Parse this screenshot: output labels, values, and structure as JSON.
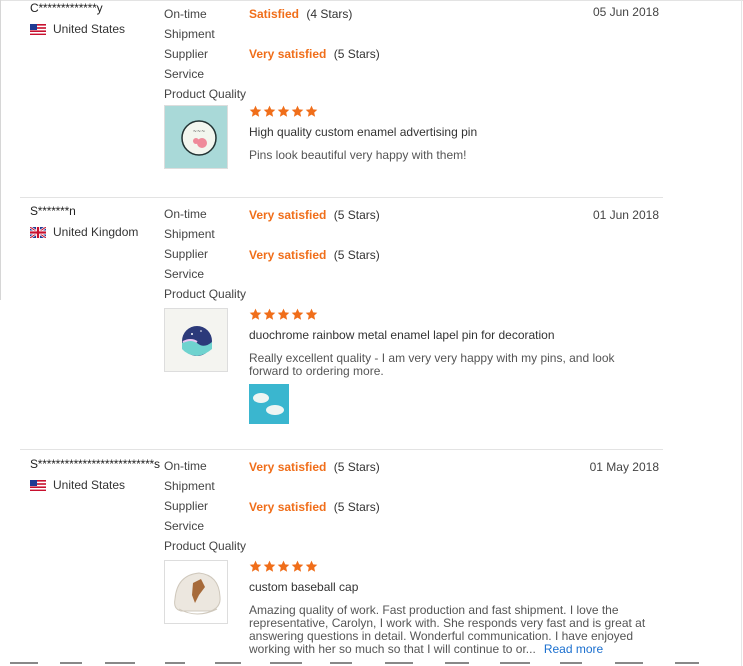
{
  "labels": {
    "ontime_1": "On-time",
    "ontime_2": "Shipment",
    "supplier_1": "Supplier",
    "supplier_2": "Service",
    "product_quality": "Product Quality",
    "read_more": "Read more"
  },
  "colors": {
    "accent": "#f06e1a",
    "link": "#1a6fcf",
    "star": "#f06e1a"
  },
  "reviews": [
    {
      "buyer": "C*************y",
      "country": "United States",
      "flag": "us-flag-icon",
      "ontime_rating": "Satisfied",
      "ontime_stars": "(4 Stars)",
      "supplier_rating": "Very satisfied",
      "supplier_stars": "(5 Stars)",
      "date": "05 Jun 2018",
      "product_stars": 5,
      "product_title": "High quality custom enamel advertising pin",
      "comment": "Pins look beautiful very happy with them!"
    },
    {
      "buyer": "S*******n",
      "country": "United Kingdom",
      "flag": "uk-flag-icon",
      "ontime_rating": "Very satisfied",
      "ontime_stars": "(5 Stars)",
      "supplier_rating": "Very satisfied",
      "supplier_stars": "(5 Stars)",
      "date": "01 Jun 2018",
      "product_stars": 5,
      "product_title": "duochrome rainbow metal enamel lapel pin for decoration",
      "comment": "Really excellent quality - I am very very happy with my pins, and look forward to ordering more."
    },
    {
      "buyer": "S**************************s",
      "country": "United States",
      "flag": "us-flag-icon",
      "ontime_rating": "Very satisfied",
      "ontime_stars": "(5 Stars)",
      "supplier_rating": "Very satisfied",
      "supplier_stars": "(5 Stars)",
      "date": "01 May 2018",
      "product_stars": 5,
      "product_title": "custom baseball cap",
      "comment": "Amazing quality of work. Fast production and fast shipment. I love the representative, Carolyn, I work with. She responds very fast and is great at answering questions in detail. Wonderful communication. I have enjoyed working with her so much so that I will continue to or..."
    }
  ]
}
